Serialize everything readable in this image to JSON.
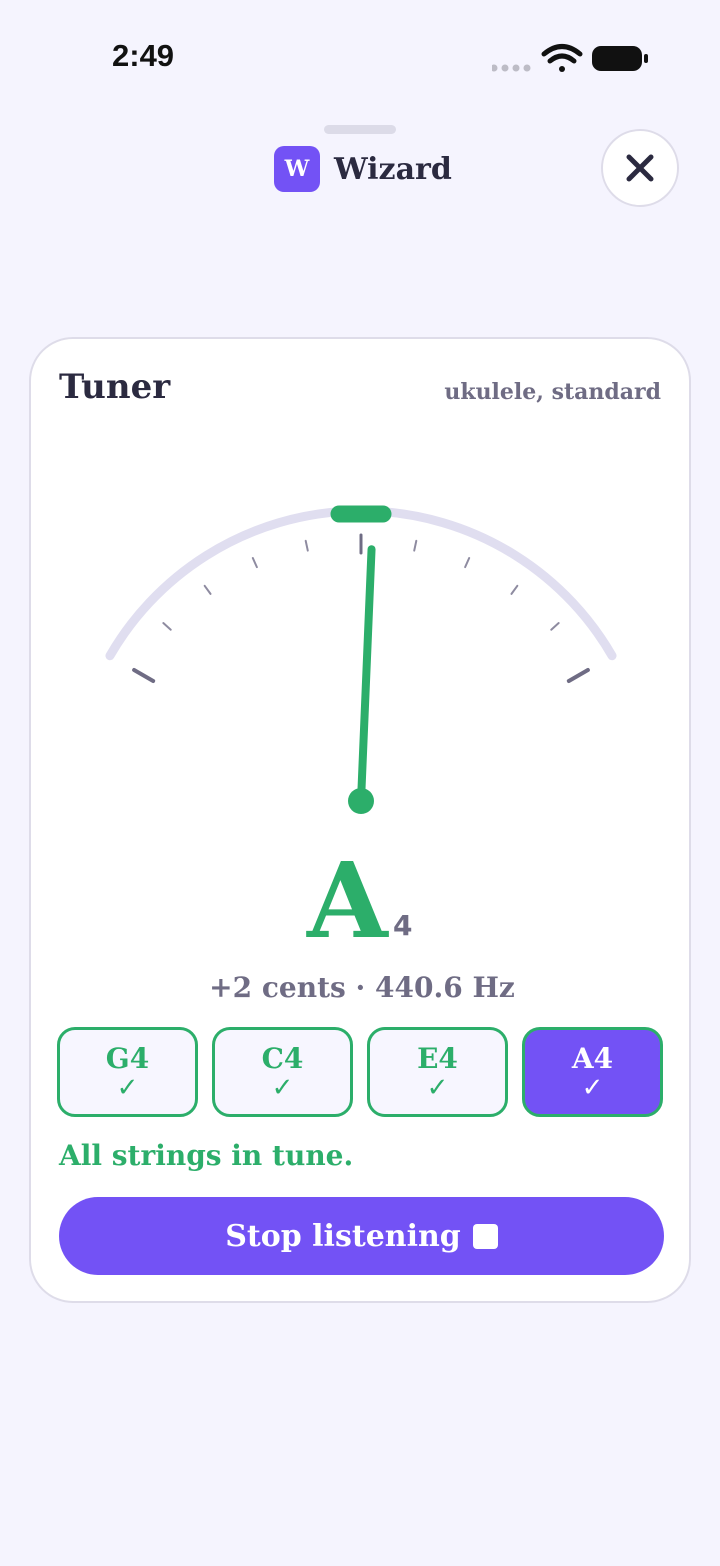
{
  "status_bar": {
    "time": "2:49"
  },
  "header": {
    "logo_letter": "W",
    "title": "Wizard"
  },
  "card": {
    "title": "Tuner",
    "subtitle": "ukulele, standard",
    "note": {
      "letter": "A",
      "octave": "4"
    },
    "readout": "+2 cents · 440.6 Hz",
    "strings": [
      {
        "label": "G4",
        "check": "✓",
        "active": false
      },
      {
        "label": "C4",
        "check": "✓",
        "active": false
      },
      {
        "label": "E4",
        "check": "✓",
        "active": false
      },
      {
        "label": "A4",
        "check": "✓",
        "active": true
      }
    ],
    "status_text": "All strings in tune.",
    "stop_label": "Stop listening"
  },
  "gauge": {
    "cents": 2,
    "min_cents": -50,
    "max_cents": 50
  },
  "colors": {
    "accent": "#7352f5",
    "in_tune": "#2cae6a",
    "muted": "#6f6c84"
  },
  "icons": {
    "close": "close-icon",
    "stop": "stop-square-icon",
    "wifi": "wifi-icon",
    "battery": "battery-icon",
    "signal": "signal-dots-icon"
  }
}
